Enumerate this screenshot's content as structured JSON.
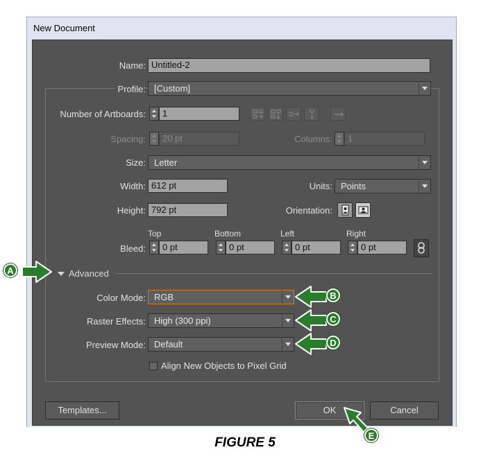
{
  "dialog": {
    "title": "New Document"
  },
  "name": {
    "label": "Name:",
    "value": "Untitled-2"
  },
  "profile": {
    "label": "Profile:",
    "value": "[Custom]"
  },
  "artboards": {
    "label": "Number of Artboards:",
    "value": "1"
  },
  "spacing": {
    "label": "Spacing:",
    "value": "20 pt"
  },
  "columns": {
    "label": "Columns:",
    "value": "1"
  },
  "size": {
    "label": "Size:",
    "value": "Letter"
  },
  "width": {
    "label": "Width:",
    "value": "612 pt"
  },
  "units": {
    "label": "Units:",
    "value": "Points"
  },
  "height": {
    "label": "Height:",
    "value": "792 pt"
  },
  "orientation": {
    "label": "Orientation:",
    "selected": "portrait"
  },
  "bleed": {
    "label": "Bleed:",
    "top": {
      "label": "Top",
      "value": "0 pt"
    },
    "bottom": {
      "label": "Bottom",
      "value": "0 pt"
    },
    "left": {
      "label": "Left",
      "value": "0 pt"
    },
    "right": {
      "label": "Right",
      "value": "0 pt"
    }
  },
  "advanced": {
    "label": "Advanced",
    "color_mode": {
      "label": "Color Mode:",
      "value": "RGB"
    },
    "raster_effects": {
      "label": "Raster Effects:",
      "value": "High (300 ppi)"
    },
    "preview_mode": {
      "label": "Preview Mode:",
      "value": "Default"
    },
    "align_pixel_grid": {
      "label": "Align New Objects to Pixel Grid",
      "checked": false
    }
  },
  "buttons": {
    "templates": "Templates...",
    "ok": "OK",
    "cancel": "Cancel"
  },
  "callouts": {
    "a": "A",
    "b": "B",
    "c": "C",
    "d": "D",
    "e": "E"
  },
  "caption": "FIGURE 5",
  "colors": {
    "dialog_bg": "#535353",
    "callout_green": "#2a7d2a",
    "highlight_orange": "#d07a24"
  }
}
